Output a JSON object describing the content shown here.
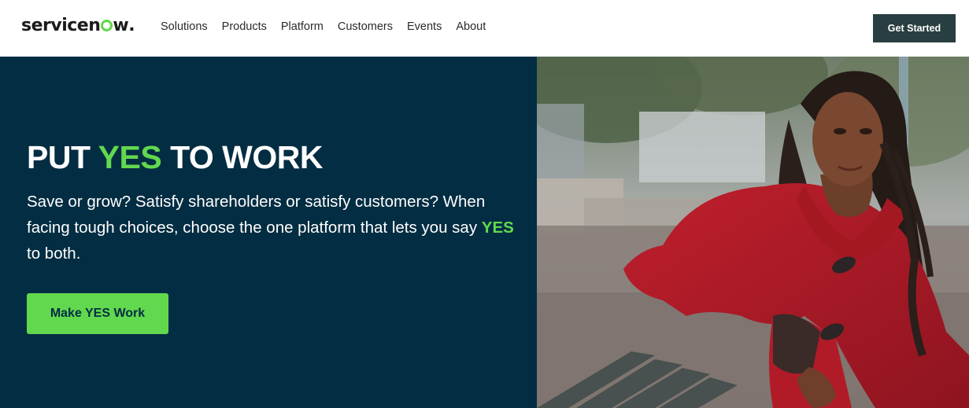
{
  "header": {
    "logo": {
      "text_before": "servicen",
      "text_after": "w",
      "text_dot": ".",
      "brand_green": "#62d84e"
    },
    "nav": [
      {
        "label": "Solutions"
      },
      {
        "label": "Products"
      },
      {
        "label": "Platform"
      },
      {
        "label": "Customers"
      },
      {
        "label": "Events"
      },
      {
        "label": "About"
      }
    ],
    "cta_label": "Get Started"
  },
  "hero": {
    "headline_part1": "PUT ",
    "headline_accent": "YES",
    "headline_part2": " TO WORK",
    "body_part1": "Save or grow? Satisfy shareholders or satisfy customers? When facing tough choices, choose the one platform that lets you say ",
    "body_accent": "YES",
    "body_part2": " to both.",
    "cta_label": "Make YES Work",
    "image_alt_icon": "hero-photo-woman-red-coat",
    "colors": {
      "background": "#032d42",
      "accent": "#62d84e",
      "header_cta": "#293e40"
    }
  }
}
